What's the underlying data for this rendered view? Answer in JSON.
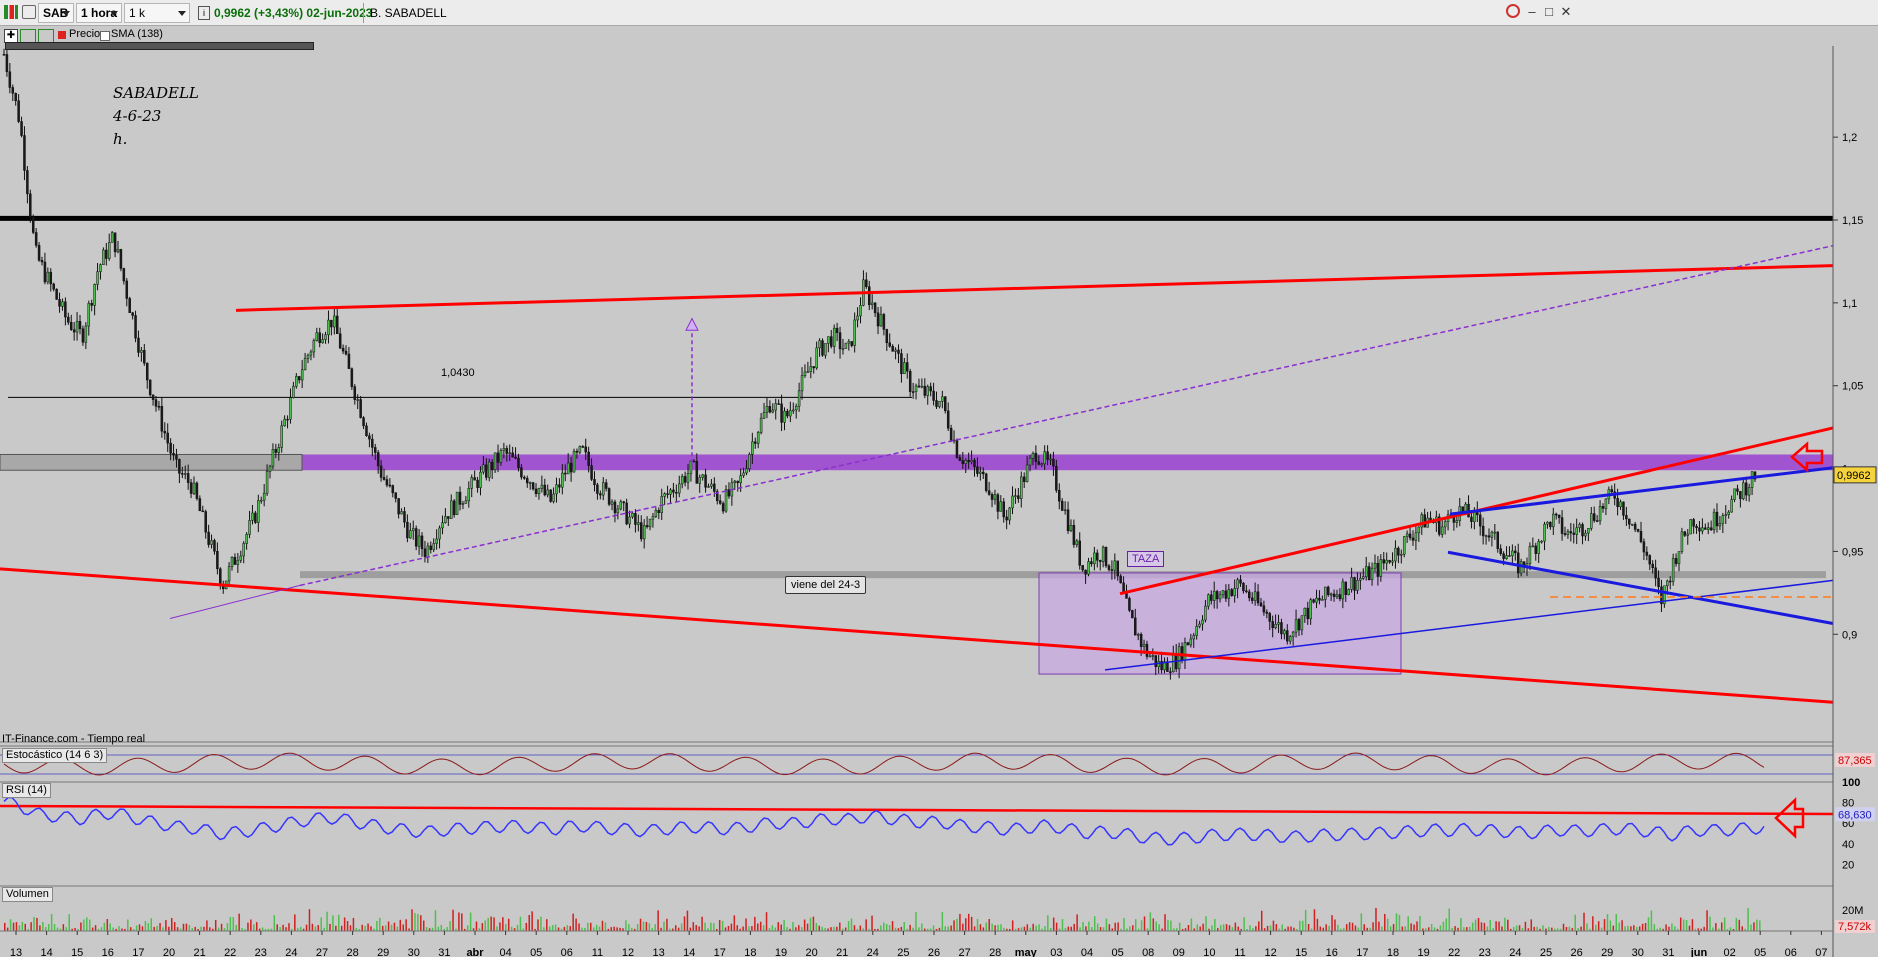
{
  "toolbar": {
    "symbol": "SAB",
    "timeframe": "1 hora",
    "units": "1 k unidades",
    "quote": "0,9962 (+3,43%) 02-jun-2023",
    "name": "B. SABADELL"
  },
  "legend": {
    "price": "Precio",
    "sma": "SMA (138)"
  },
  "annotations": {
    "title1": "SABADELL",
    "title2": "4-6-23",
    "title3": "h.",
    "level": "1,0430",
    "cup": "TAZA",
    "note": "viene del 24-3",
    "source": "IT-Finance.com - Tiempo real"
  },
  "colors": {
    "background": "#c9c9c9",
    "trend_red": "#ff0000",
    "trend_blue": "#1a1adf",
    "purple_zone": "#9a3fd0",
    "candle_up": "#4fbf4f",
    "candle_down": "#1a1a1a",
    "rsi": "#3535ff"
  },
  "chart_data": [
    {
      "type": "candlestick",
      "title": "SABADELL 4-6-23 h.",
      "x_tick_labels": [
        "13",
        "14",
        "15",
        "16",
        "17",
        "20",
        "21",
        "22",
        "23",
        "24",
        "27",
        "28",
        "29",
        "30",
        "31",
        "abr",
        "04",
        "05",
        "06",
        "11",
        "12",
        "13",
        "14",
        "17",
        "18",
        "19",
        "20",
        "21",
        "24",
        "25",
        "26",
        "27",
        "28",
        "may",
        "03",
        "04",
        "05",
        "08",
        "09",
        "10",
        "11",
        "12",
        "15",
        "16",
        "17",
        "18",
        "19",
        "22",
        "23",
        "24",
        "25",
        "26",
        "29",
        "30",
        "31",
        "jun",
        "02",
        "05",
        "06",
        "07"
      ],
      "y_ticks": [
        0.9,
        0.95,
        1.0,
        1.05,
        1.1,
        1.15,
        1.2
      ],
      "y_tick_labels": [
        "0,9",
        "0,95",
        "1",
        "1,05",
        "1,1",
        "1,15",
        "1,2"
      ],
      "ylim": [
        0.835,
        1.255
      ],
      "last_price": 0.9962,
      "last_price_label": "0,9962",
      "close_path": [
        1.25,
        1.21,
        1.13,
        1.11,
        1.09,
        1.08,
        1.12,
        1.14,
        1.1,
        1.06,
        1.03,
        1.0,
        0.99,
        0.96,
        0.93,
        0.95,
        0.97,
        1.0,
        1.03,
        1.06,
        1.08,
        1.09,
        1.06,
        1.03,
        1.0,
        0.98,
        0.96,
        0.95,
        0.97,
        0.98,
        0.99,
        1.0,
        1.01,
        1.0,
        0.99,
        0.98,
        1.0,
        1.01,
        0.99,
        0.98,
        0.97,
        0.96,
        0.98,
        0.99,
        1.0,
        0.99,
        0.98,
        0.99,
        1.02,
        1.04,
        1.03,
        1.05,
        1.07,
        1.08,
        1.07,
        1.11,
        1.09,
        1.07,
        1.05,
        1.045,
        1.04,
        1.01,
        1.0,
        0.99,
        0.97,
        0.99,
        1.01,
        1.0,
        0.97,
        0.94,
        0.95,
        0.94,
        0.91,
        0.89,
        0.88,
        0.885,
        0.9,
        0.92,
        0.925,
        0.93,
        0.92,
        0.91,
        0.9,
        0.91,
        0.92,
        0.925,
        0.93,
        0.935,
        0.94,
        0.95,
        0.96,
        0.97,
        0.965,
        0.975,
        0.97,
        0.96,
        0.95,
        0.94,
        0.955,
        0.97,
        0.96,
        0.965,
        0.975,
        0.985,
        0.97,
        0.95,
        0.92,
        0.95,
        0.97,
        0.965,
        0.975,
        0.985,
        0.9962
      ],
      "horizontal_levels": [
        {
          "value": 1.151,
          "label": ""
        },
        {
          "value": 1.043,
          "label": "1,0430"
        },
        {
          "value": 0.936,
          "label": ""
        }
      ],
      "purple_zone": [
        0.999,
        1.0085
      ],
      "cup_box": {
        "x_from": "28 abr",
        "x_to": "18 may",
        "y": [
          0.876,
          0.937
        ],
        "label": "TAZA"
      }
    },
    {
      "type": "line",
      "title": "Estocástico (14 6 3)",
      "last_value_label": "87,365"
    },
    {
      "type": "line",
      "title": "RSI (14)",
      "y_ticks": [
        20,
        40,
        60,
        80,
        100
      ],
      "y_tick_labels": [
        "20",
        "40",
        "60",
        "80",
        "100"
      ],
      "ylim": [
        0,
        100
      ],
      "last_value": 68.63,
      "last_value_label": "68,630"
    },
    {
      "type": "bar",
      "title": "Volumen",
      "y_tick_labels": [
        "20M"
      ],
      "last_value_label": "7,572k"
    }
  ]
}
